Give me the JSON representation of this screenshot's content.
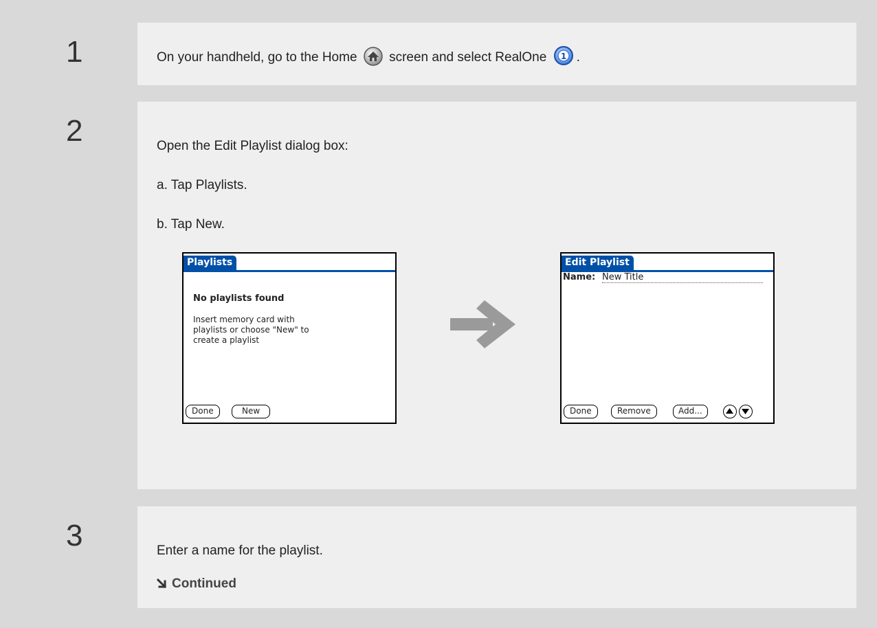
{
  "steps": [
    {
      "number": "1",
      "text_a": "On your handheld, go to the Home",
      "text_b": "screen and select RealOne",
      "icons": [
        "home-icon",
        "realone-icon"
      ]
    },
    {
      "number": "2",
      "intro": "Open the Edit Playlist dialog box:",
      "substeps": [
        "a.  Tap Playlists.",
        "b.  Tap New."
      ],
      "screen_left": {
        "title": "Playlists",
        "heading": "No playlists found",
        "body_lines": [
          "Insert memory card with",
          "playlists or choose \"New\" to",
          "create a playlist"
        ],
        "buttons": [
          "Done",
          "New"
        ]
      },
      "arrow_icon": "right-arrow-icon",
      "screen_right": {
        "title": "Edit Playlist",
        "name_label": "Name:",
        "name_value": "New Title",
        "buttons": [
          "Done",
          "Remove",
          "Add..."
        ],
        "scroll_icons": [
          "scroll-up-icon",
          "scroll-down-icon"
        ]
      }
    },
    {
      "number": "3",
      "text": "Enter a name for the playlist.",
      "continued": "Continued",
      "continued_icon": "continued-arrow-icon"
    }
  ],
  "colors": {
    "accent": "#0050a8",
    "panel": "#efefef",
    "gutter": "#d9d9d9"
  }
}
